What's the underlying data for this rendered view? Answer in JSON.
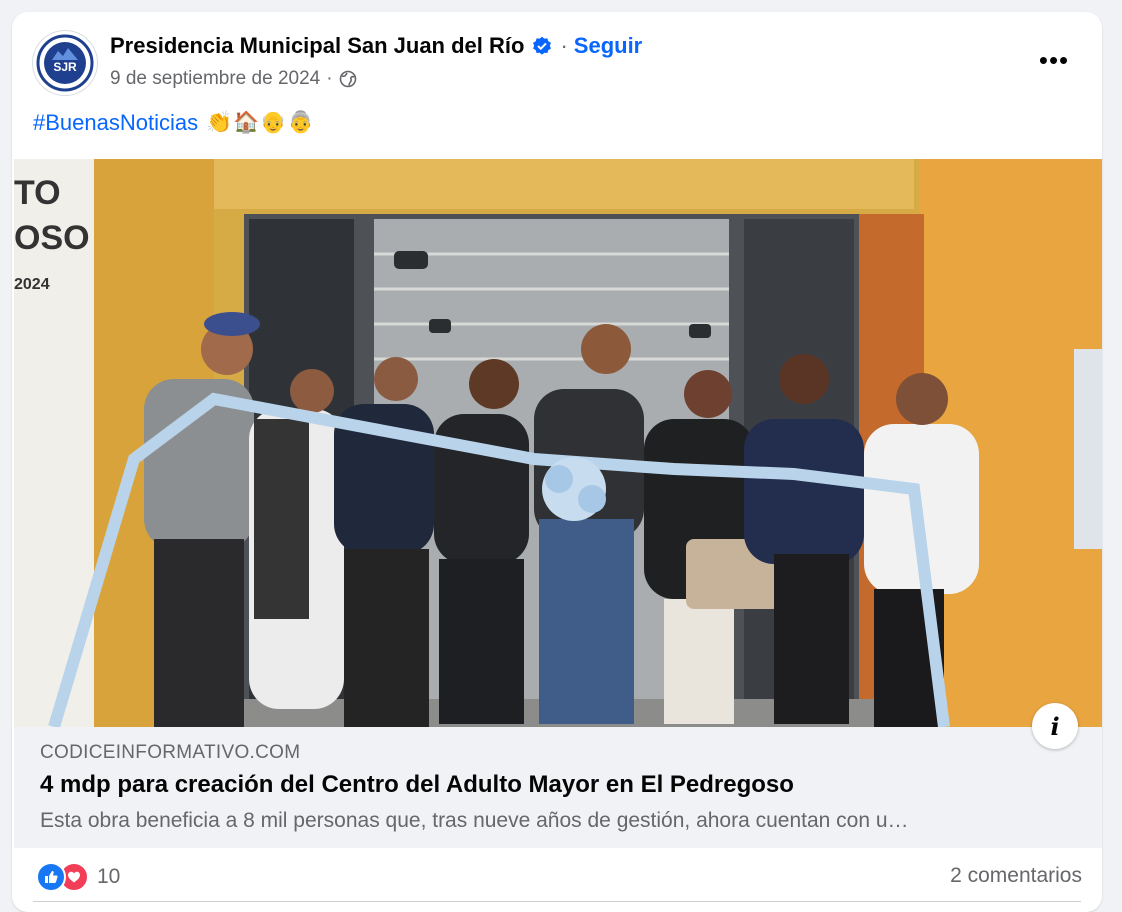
{
  "post": {
    "author": "Presidencia Municipal San Juan del Río",
    "avatar_text": "SJR",
    "separator": "·",
    "follow_label": "Seguir",
    "date": "9 de septiembre de 2024",
    "hashtag": "#BuenasNoticias",
    "emojis": "👏🏠👴👵",
    "more_label": "•••"
  },
  "photo": {
    "wall_text_line1": "TO",
    "wall_text_line2": "OSO",
    "wall_text_line3": "2024",
    "info_label": "i"
  },
  "link_preview": {
    "domain": "CODICEINFORMATIVO.COM",
    "title": "4 mdp para creación del Centro del Adulto Mayor en El Pedregoso",
    "description": "Esta obra beneficia a 8 mil personas que, tras nueve años de gestión, ahora cuentan con u…"
  },
  "footer": {
    "reaction_count": "10",
    "comments": "2 comentarios"
  },
  "colors": {
    "accent": "#0866ff",
    "like": "#1877f2",
    "love": "#f33e58"
  }
}
